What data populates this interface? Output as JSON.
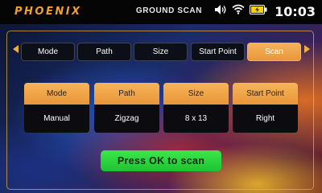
{
  "header": {
    "logo": "PHOENIX",
    "title": "GROUND SCAN",
    "time": "10:03",
    "icons": [
      "speaker-icon",
      "wifi-icon",
      "battery-charging-icon"
    ]
  },
  "tabs": [
    {
      "label": "Mode",
      "active": false
    },
    {
      "label": "Path",
      "active": false
    },
    {
      "label": "Size",
      "active": false
    },
    {
      "label": "Start Point",
      "active": false
    },
    {
      "label": "Scan",
      "active": true
    }
  ],
  "summary": [
    {
      "label": "Mode",
      "value": "Manual"
    },
    {
      "label": "Path",
      "value": "Zigzag"
    },
    {
      "label": "Size",
      "value": "8 x 13"
    },
    {
      "label": "Start Point",
      "value": "Right"
    }
  ],
  "action": {
    "label": "Press OK to scan"
  },
  "colors": {
    "accent": "#f0a030",
    "active_tab": "#f3a850",
    "ok_button": "#2ad23c"
  }
}
